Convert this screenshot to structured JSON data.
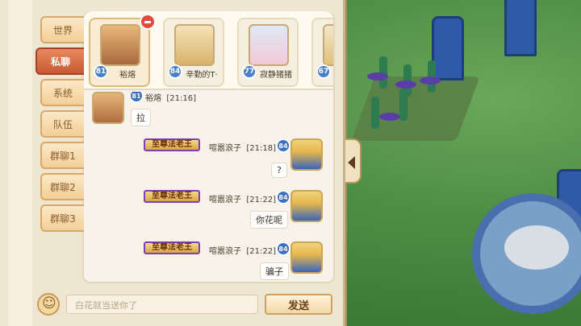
{
  "tabs": [
    {
      "label": "世界",
      "active": false
    },
    {
      "label": "私聊",
      "active": true
    },
    {
      "label": "系统",
      "active": false
    },
    {
      "label": "队伍",
      "active": false
    },
    {
      "label": "群聊1",
      "active": false
    },
    {
      "label": "群聊2",
      "active": false
    },
    {
      "label": "群聊3",
      "active": false
    }
  ],
  "friends": [
    {
      "name": "裕熔",
      "level": "81",
      "selected": true
    },
    {
      "name": "辛勤的T·",
      "level": "84",
      "selected": false
    },
    {
      "name": "寂静猪猪",
      "level": "77",
      "selected": false
    },
    {
      "name": "",
      "level": "67",
      "selected": false
    }
  ],
  "messages": {
    "first": {
      "sender": "裕熔",
      "time": "[21:16]",
      "level": "81",
      "text": "拉"
    },
    "replies": [
      {
        "title": "至尊法老王",
        "sender": "喧嚣浪子",
        "time": "[21:18]",
        "level": "84",
        "text": "?"
      },
      {
        "title": "至尊法老王",
        "sender": "喧嚣浪子",
        "time": "[21:22]",
        "level": "84",
        "text": "你花呢"
      },
      {
        "title": "至尊法老王",
        "sender": "喧嚣浪子",
        "time": "[21:22]",
        "level": "84",
        "text": "骗子"
      }
    ]
  },
  "input": {
    "value": "白花就当送你了"
  },
  "send_label": "发送",
  "colors": {
    "active_tab": "#c85a35",
    "panel_bg": "#efe6d2",
    "title_border": "#7c3fb6"
  }
}
